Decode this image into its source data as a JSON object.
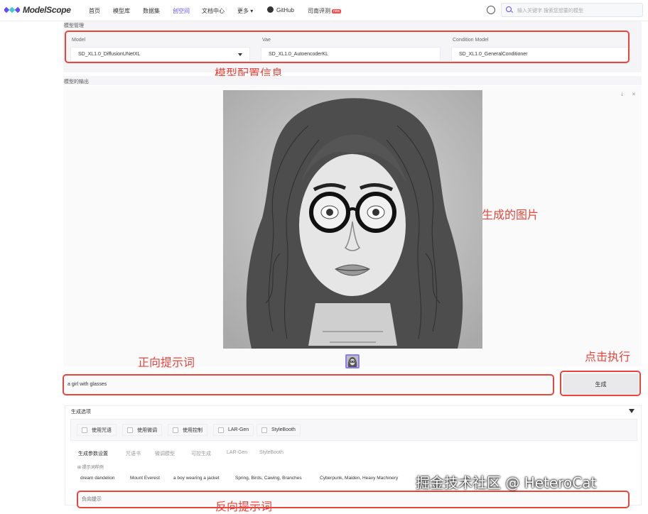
{
  "brand": {
    "logo_text": "ModelScope"
  },
  "nav": {
    "items": [
      "首页",
      "模型库",
      "数据集",
      "创空间",
      "文档中心",
      "更多 ▾",
      "GitHub",
      "司南评测"
    ],
    "hot_badge": "new",
    "active_index": 3
  },
  "search": {
    "placeholder": "输入关键字 搜索您想要的模型"
  },
  "model_panel": {
    "title": "模型管理",
    "fields": [
      {
        "label": "Model",
        "value": "SD_XL1.0_DiffusionUNetXL"
      },
      {
        "label": "Vae",
        "value": "SD_XL1.0_AutoencoderKL"
      },
      {
        "label": "Condition Model",
        "value": "SD_XL1.0_GeneralConditioner"
      }
    ]
  },
  "output_panel": {
    "title": "模型的输出"
  },
  "prompt": {
    "value": "a girl with glasses"
  },
  "generate_button": {
    "label": "生成"
  },
  "options": {
    "title": "生成选项",
    "checkboxes": [
      "使用咒语",
      "使用微调",
      "使用控制",
      "LAR-Gen",
      "StyleBooth"
    ],
    "tabs": [
      "生成参数设置",
      "咒语书",
      "微调模型",
      "可控生成",
      "LAR-Gen",
      "StyleBooth"
    ],
    "examples_label": "⊞ 提示词样例",
    "examples": [
      "dream dandelion",
      "Mount Everest",
      "a boy wearing a jacket",
      "Spring, Birds, Cawing, Branches",
      "Cyberpunk, Maiden, Heavy Machinery"
    ],
    "negative_label": "负向提示"
  },
  "annotations": {
    "config": "模型配置信息",
    "image": "生成的图片",
    "prompt": "正向提示词",
    "execute": "点击执行",
    "negative": "反向提示词"
  },
  "watermark": "掘金技术社区 @ HeteroCat",
  "colors": {
    "accent": "#624aff",
    "annotation_red": "#e8453c"
  }
}
